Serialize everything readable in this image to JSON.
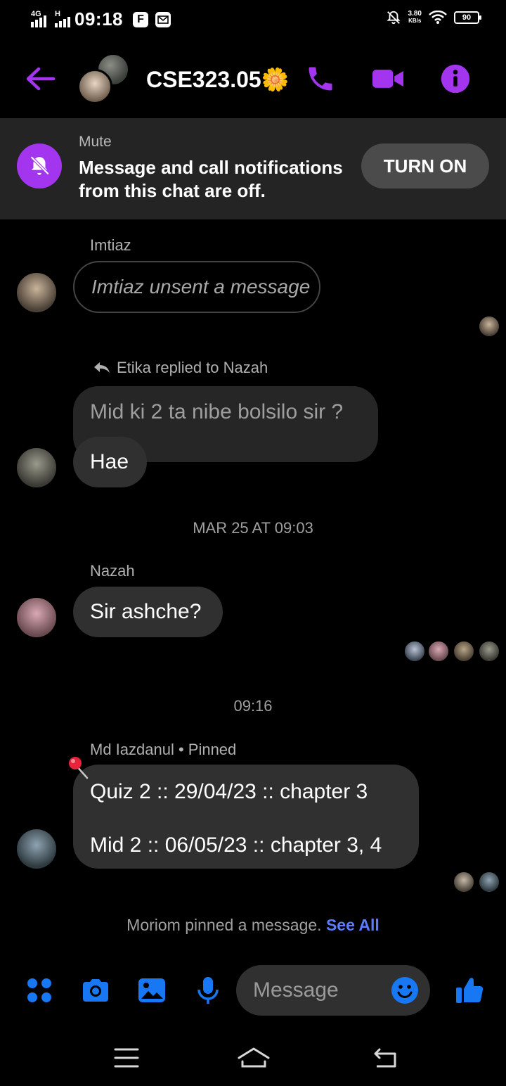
{
  "status_bar": {
    "network_1": "4G",
    "network_2": "H",
    "time": "09:18",
    "app_icon_1": "F",
    "speed_value": "3.80",
    "speed_unit": "KB/s",
    "battery": "90"
  },
  "header": {
    "title": "CSE323.05🌼",
    "icons": [
      "back-arrow-icon",
      "phone-icon",
      "video-camera-icon",
      "info-icon"
    ],
    "accent_color": "#a335ee"
  },
  "mute_banner": {
    "label": "Mute",
    "text": "Message and call notifications from this chat are off.",
    "button": "TURN ON"
  },
  "messages": {
    "imtiaz_name": "Imtiaz",
    "imtiaz_unsent": "Imtiaz unsent a message",
    "reply_context": "Etika replied to Nazah",
    "quoted_text": "Mid ki 2 ta nibe bolsilo sir ?",
    "etika_reply": "Hae",
    "date_1": "MAR 25 AT 09:03",
    "nazah_name": "Nazah",
    "nazah_msg": "Sir ashche?",
    "date_2": "09:16",
    "pinned_sender": "Md Iazdanul • Pinned",
    "pinned_line_1": "Quiz 2 :: 29/04/23 :: chapter 3",
    "pinned_line_2": "Mid 2 :: 06/05/23 :: chapter 3, 4",
    "system_text": "Moriom pinned a message.",
    "system_link": "See All"
  },
  "composer": {
    "placeholder": "Message",
    "icons": [
      "menu-grid-icon",
      "camera-icon",
      "gallery-icon",
      "microphone-icon",
      "emoji-icon",
      "thumbs-up-icon"
    ],
    "accent_color": "#1877f2"
  },
  "nav_bar": {
    "icons": [
      "recents-icon",
      "home-icon",
      "back-icon"
    ]
  }
}
